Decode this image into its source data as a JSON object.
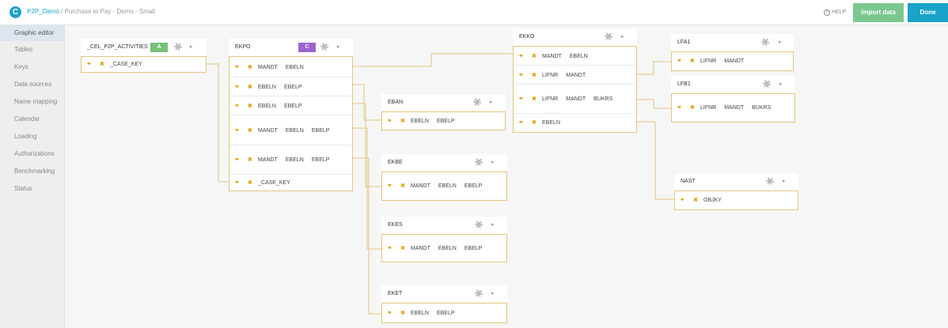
{
  "header": {
    "logo_letter": "C",
    "breadcrumb_link": "P2P_Demo",
    "breadcrumb_separator": " / ",
    "breadcrumb_current": "Purchase to Pay - Demo - Small",
    "help_label": "HELP",
    "import_label": "Import data",
    "done_label": "Done"
  },
  "sidebar": {
    "items": [
      {
        "label": "Graphic editor",
        "active": true
      },
      {
        "label": "Tables"
      },
      {
        "label": "Keys"
      },
      {
        "label": "Data sources"
      },
      {
        "label": "Name mapping"
      },
      {
        "label": "Calendar"
      },
      {
        "label": "Loading"
      },
      {
        "label": "Authorizations"
      },
      {
        "label": "Benchmarking"
      },
      {
        "label": "Status"
      }
    ]
  },
  "colors": {
    "accent": "#1aa3c8",
    "import_button": "#7bc88f",
    "badge_activity": "#77c17a",
    "badge_case": "#9b63cf",
    "connector": "#e3c77f",
    "key_icon": "#e2a419"
  },
  "icons": {
    "key": "key-icon",
    "delete": "close-icon",
    "settings": "gear-icon",
    "expand": "chevron-right-icon",
    "help": "help-circle-icon"
  },
  "tables": [
    {
      "id": "cel",
      "name": "_CEL_P2P_ACTIVITIES",
      "badge": "A",
      "rows": [
        [
          "_CASE_KEY"
        ]
      ]
    },
    {
      "id": "ekpo",
      "name": "EKPO",
      "badge": "C",
      "rows": [
        [
          "MANDT",
          "EBELN"
        ],
        [
          "EBELN",
          "EBELP"
        ],
        [
          "EBELN",
          "EBELP"
        ],
        [
          "MANDT",
          "EBELN",
          "EBELP"
        ],
        [
          "MANDT",
          "EBELN",
          "EBELP"
        ],
        [
          "_CASE_KEY"
        ]
      ]
    },
    {
      "id": "ekko",
      "name": "EKKO",
      "rows": [
        [
          "MANDT",
          "EBELN"
        ],
        [
          "LIFNR",
          "MANDT"
        ],
        [
          "LIFNR",
          "MANDT",
          "BUKRS"
        ],
        [
          "EBELN"
        ]
      ]
    },
    {
      "id": "lfa1",
      "name": "LFA1",
      "rows": [
        [
          "LIFNR",
          "MANDT"
        ]
      ]
    },
    {
      "id": "lfb1",
      "name": "LFB1",
      "rows": [
        [
          "LIFNR",
          "MANDT",
          "BUKRS"
        ]
      ]
    },
    {
      "id": "eban",
      "name": "EBAN",
      "rows": [
        [
          "EBELN",
          "EBELP"
        ]
      ]
    },
    {
      "id": "ekbe",
      "name": "EKBE",
      "rows": [
        [
          "MANDT",
          "EBELN",
          "EBELP"
        ]
      ]
    },
    {
      "id": "ekes",
      "name": "EKES",
      "rows": [
        [
          "MANDT",
          "EBELN",
          "EBELP"
        ]
      ]
    },
    {
      "id": "eket",
      "name": "EKET",
      "rows": [
        [
          "EBELN",
          "EBELP"
        ]
      ]
    },
    {
      "id": "nast",
      "name": "NAST",
      "rows": [
        [
          "OBJKY"
        ]
      ]
    }
  ]
}
